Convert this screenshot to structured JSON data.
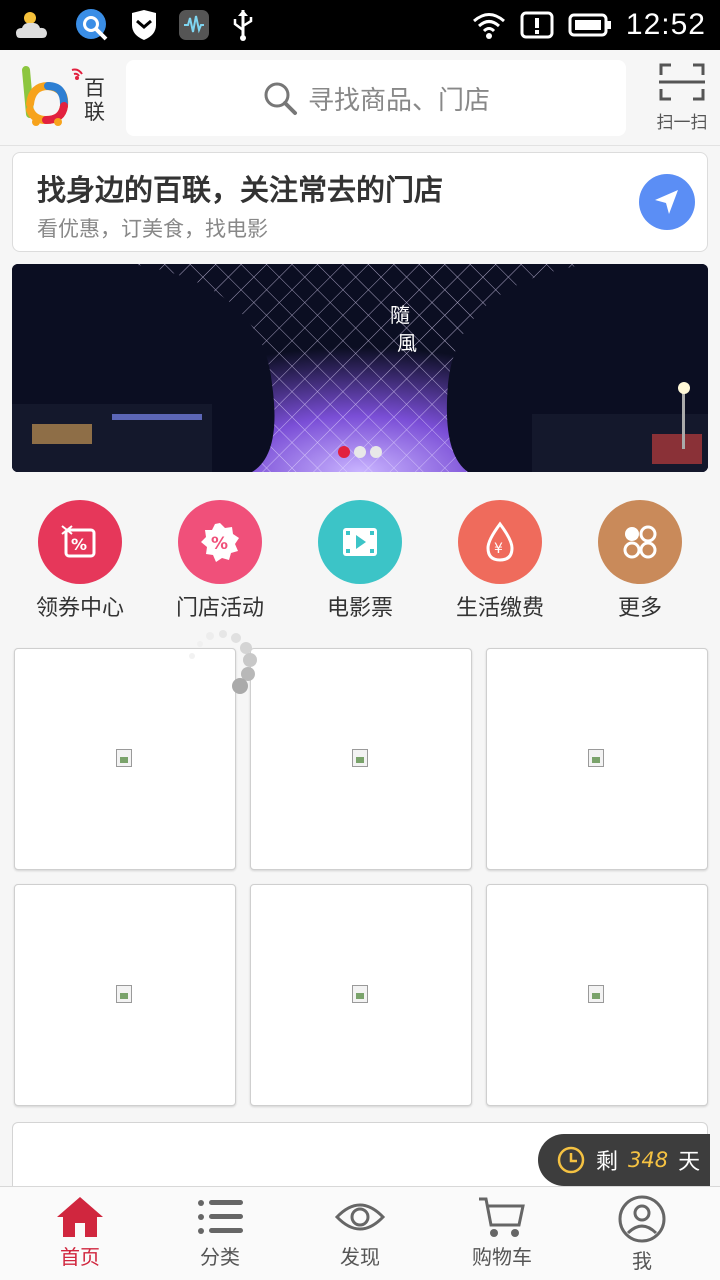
{
  "status_bar": {
    "time": "12:52"
  },
  "header": {
    "logo_text": "百联",
    "search_placeholder": "寻找商品、门店",
    "scan_label": "扫一扫"
  },
  "store_finder": {
    "title": "找身边的百联，关注常去的门店",
    "subtitle": "看优惠，订美食，找电影"
  },
  "banner": {
    "dots": 3,
    "active_index": 0
  },
  "quick_entries": [
    {
      "label": "领券中心",
      "icon": "coupon-icon",
      "color": "#e6375a"
    },
    {
      "label": "门店活动",
      "icon": "percent-badge-icon",
      "color": "#f0507a"
    },
    {
      "label": "电影票",
      "icon": "film-icon",
      "color": "#3cc4c7"
    },
    {
      "label": "生活缴费",
      "icon": "yuan-drop-icon",
      "color": "#ef6b5c"
    },
    {
      "label": "更多",
      "icon": "more-circles-icon",
      "color": "#c98a5a"
    }
  ],
  "trial_badge": {
    "prefix": "剩",
    "days": "348",
    "suffix": "天"
  },
  "tabbar": [
    {
      "label": "首页",
      "icon": "home-icon",
      "active": true
    },
    {
      "label": "分类",
      "icon": "list-icon",
      "active": false
    },
    {
      "label": "发现",
      "icon": "eye-icon",
      "active": false
    },
    {
      "label": "购物车",
      "icon": "cart-icon",
      "active": false
    },
    {
      "label": "我",
      "icon": "user-icon",
      "active": false
    }
  ],
  "colors": {
    "accent": "#d0263e",
    "locate_button": "#5b8ef5",
    "trial_number": "#f5c242"
  }
}
